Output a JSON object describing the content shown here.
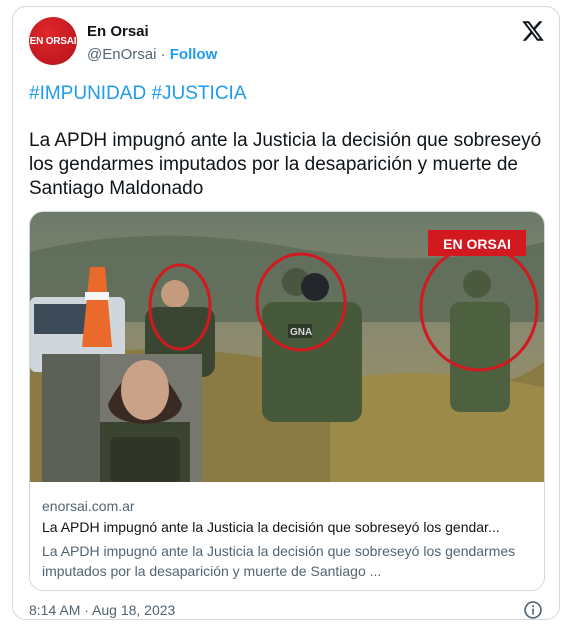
{
  "author": {
    "avatar_text": "EN ORSAI",
    "name": "En Orsai",
    "handle": "@EnOrsai",
    "separator": "·",
    "follow_label": "Follow"
  },
  "tweet": {
    "hashtags": [
      "#IMPUNIDAD",
      "#JUSTICIA"
    ],
    "text": "La APDH impugnó ante la Justicia la decisión que sobreseyó los gendarmes imputados por la desaparición y muerte de Santiago Maldonado"
  },
  "link_card": {
    "watermark": "EN ORSAI",
    "badge_text": "GNA",
    "domain": "enorsai.com.ar",
    "title": "La APDH impugnó ante la Justicia la decisión que sobreseyó los gendar...",
    "description": "La APDH impugnó ante la Justicia la decisión que sobreseyó los gendarmes imputados por la desaparición y muerte de Santiago ..."
  },
  "footer": {
    "timestamp": "8:14 AM · Aug 18, 2023"
  },
  "colors": {
    "accent": "#1d9bf0",
    "brand_red": "#d1191f",
    "text": "#0f1419",
    "muted": "#536471",
    "border": "#cfd9de"
  },
  "icons": [
    "x-logo-icon",
    "info-icon"
  ]
}
